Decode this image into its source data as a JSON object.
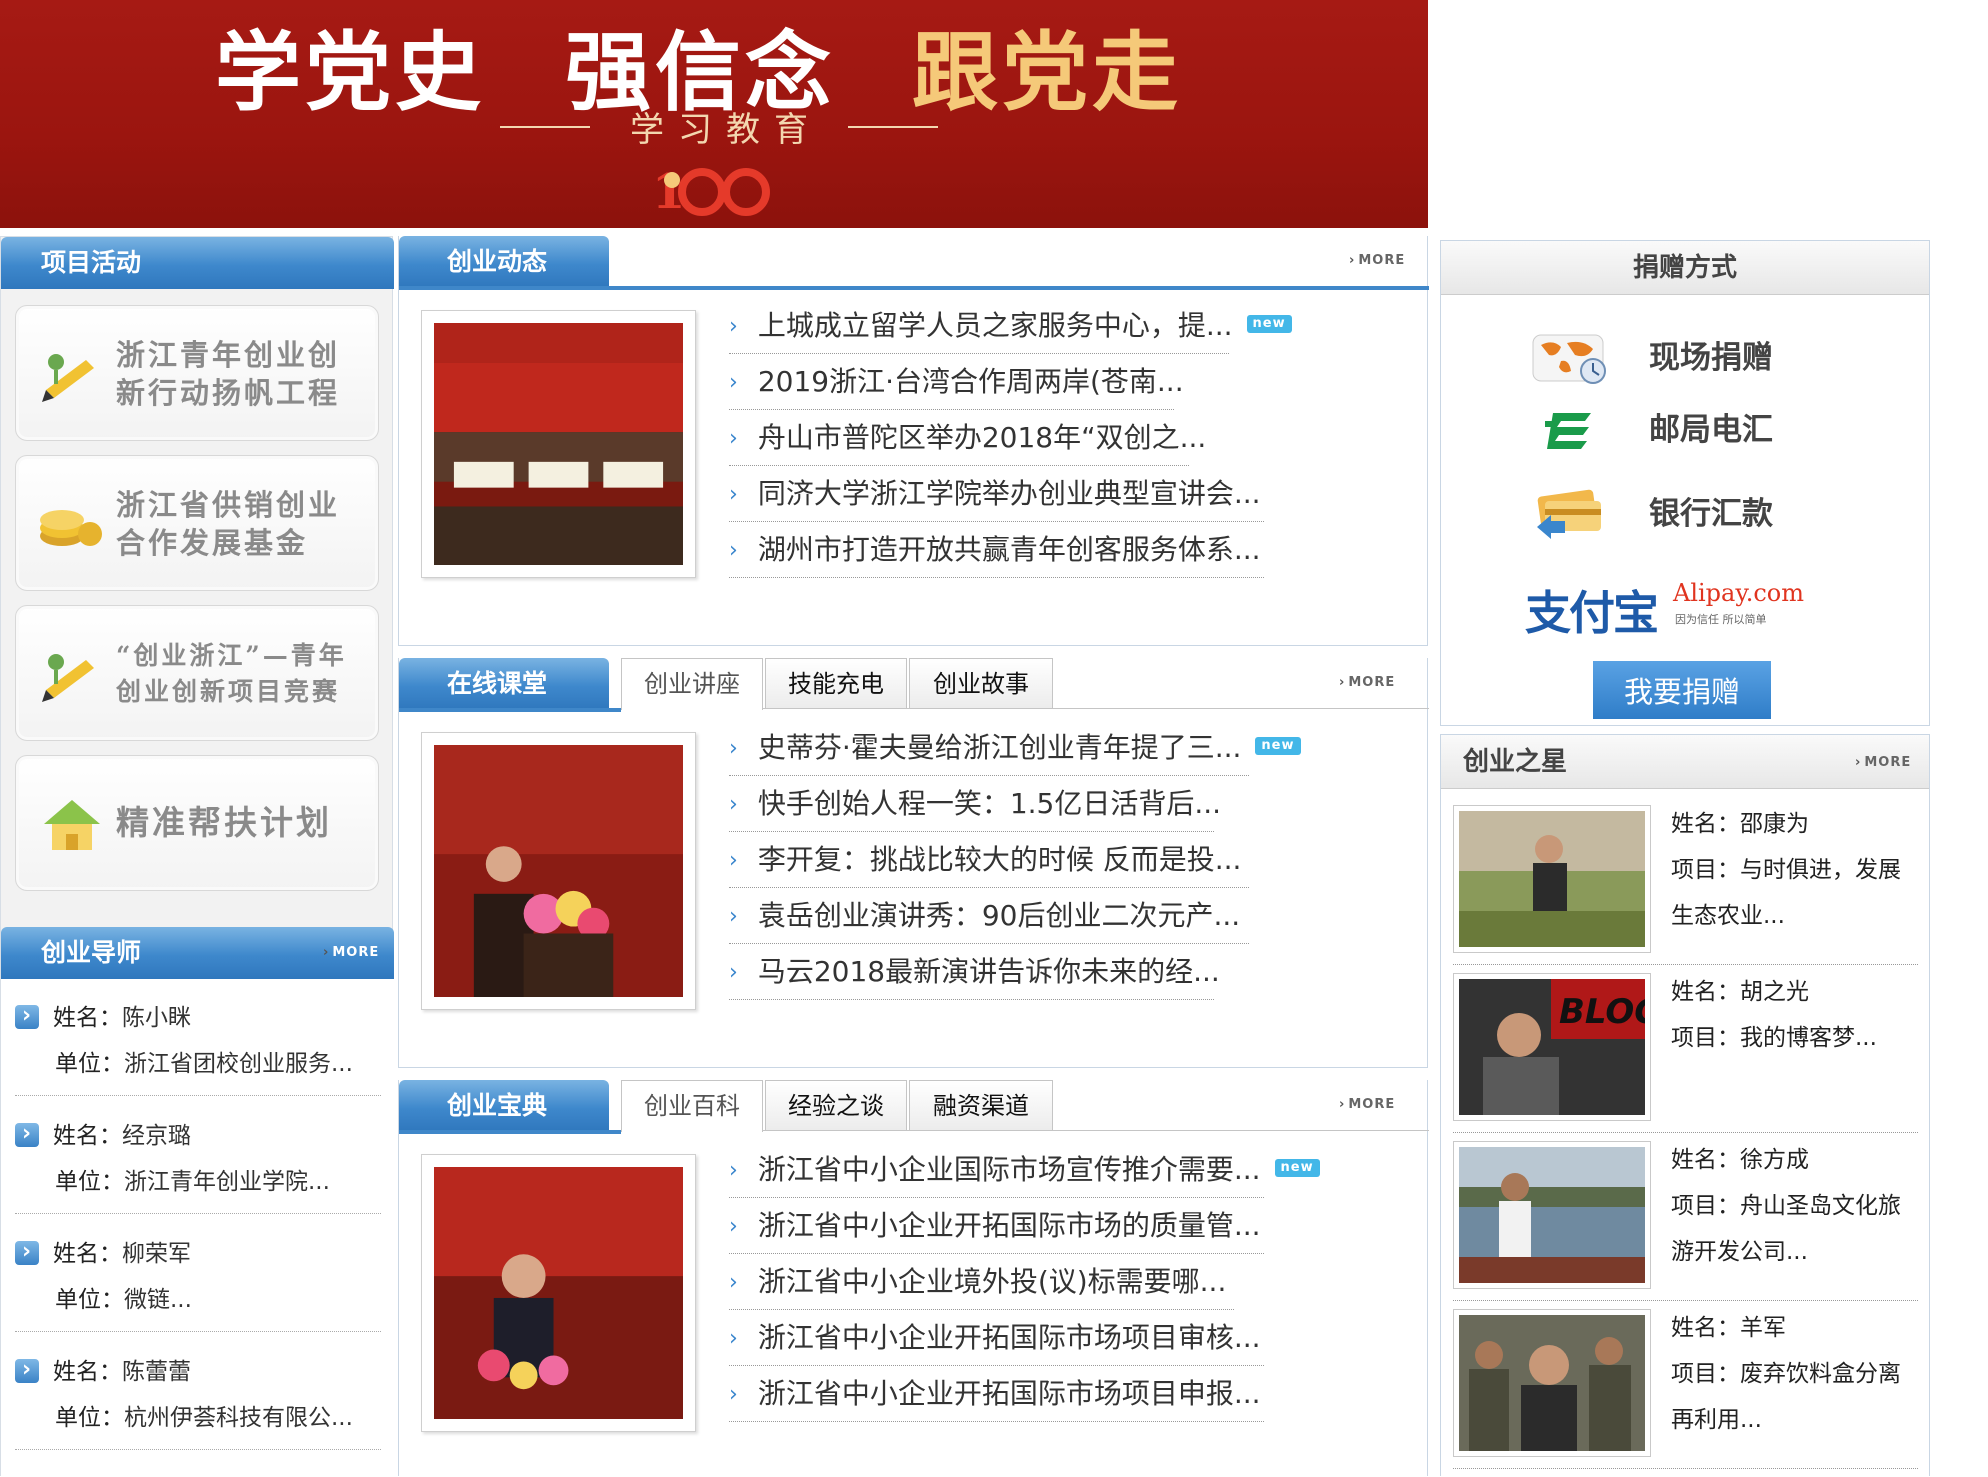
{
  "banner": {
    "title_1": "学党史",
    "title_2": "强信念",
    "title_3": "跟党走",
    "subtitle": "学习教育"
  },
  "more_label": "MORE",
  "new_label": "new",
  "projects": {
    "title": "项目活动",
    "items": [
      {
        "label": "浙江青年创业创新行动扬帆工程"
      },
      {
        "label": "浙江省供销创业合作发展基金"
      },
      {
        "label": "“创业浙江”—青年创业创新项目竞赛"
      },
      {
        "label": "精准帮扶计划"
      }
    ]
  },
  "mentors": {
    "title": "创业导师",
    "name_label": "姓名：",
    "unit_label": "单位：",
    "items": [
      {
        "name": "陈小眯",
        "unit": "浙江省团校创业服务..."
      },
      {
        "name": "经京璐",
        "unit": "浙江青年创业学院..."
      },
      {
        "name": "柳荣军",
        "unit": "微链..."
      },
      {
        "name": "陈蕾蕾",
        "unit": "杭州伊荟科技有限公..."
      }
    ]
  },
  "dynamics": {
    "title": "创业动态",
    "items": [
      "上城成立留学人员之家服务中心，提...",
      "2019浙江·台湾合作周两岸(苍南...",
      "舟山市普陀区举办2018年“双创之...",
      "同济大学浙江学院举办创业典型宣讲会...",
      "湖州市打造开放共赢青年创客服务体系..."
    ]
  },
  "classroom": {
    "title": "在线课堂",
    "tabs": [
      "创业讲座",
      "技能充电",
      "创业故事"
    ],
    "items": [
      "史蒂芬·霍夫曼给浙江创业青年提了三...",
      "快手创始人程一笑：1.5亿日活背后...",
      "李开复：挑战比较大的时候 反而是投...",
      "袁岳创业演讲秀：90后创业二次元产...",
      "马云2018最新演讲告诉你未来的经..."
    ]
  },
  "handbook": {
    "title": "创业宝典",
    "tabs": [
      "创业百科",
      "经验之谈",
      "融资渠道"
    ],
    "items": [
      "浙江省中小企业国际市场宣传推介需要...",
      "浙江省中小企业开拓国际市场的质量管...",
      "浙江省中小企业境外投(议)标需要哪...",
      "浙江省中小企业开拓国际市场项目审核...",
      "浙江省中小企业开拓国际市场项目申报..."
    ]
  },
  "donation": {
    "title": "捐赠方式",
    "methods": [
      "现场捐赠",
      "邮局电汇",
      "银行汇款"
    ],
    "alipay_cn": "支付宝",
    "alipay_en": "Alipay.com",
    "alipay_tag": "因为信任 所以简单",
    "button": "我要捐赠"
  },
  "stars": {
    "title": "创业之星",
    "name_label": "姓名：",
    "project_label": "项目：",
    "items": [
      {
        "name": "邵康为",
        "project_1": "与时俱进，发展",
        "project_2": "生态农业..."
      },
      {
        "name": "胡之光",
        "project_1": "我的博客梦...",
        "project_2": ""
      },
      {
        "name": "徐方成",
        "project_1": "舟山圣岛文化旅",
        "project_2": "游开发公司..."
      },
      {
        "name": "羊军",
        "project_1": "废弃饮料盒分离",
        "project_2": "再利用..."
      }
    ]
  },
  "colors": {
    "banner_red": "#9b150f",
    "accent_blue": "#3e88cc",
    "gold": "#f5c979"
  }
}
